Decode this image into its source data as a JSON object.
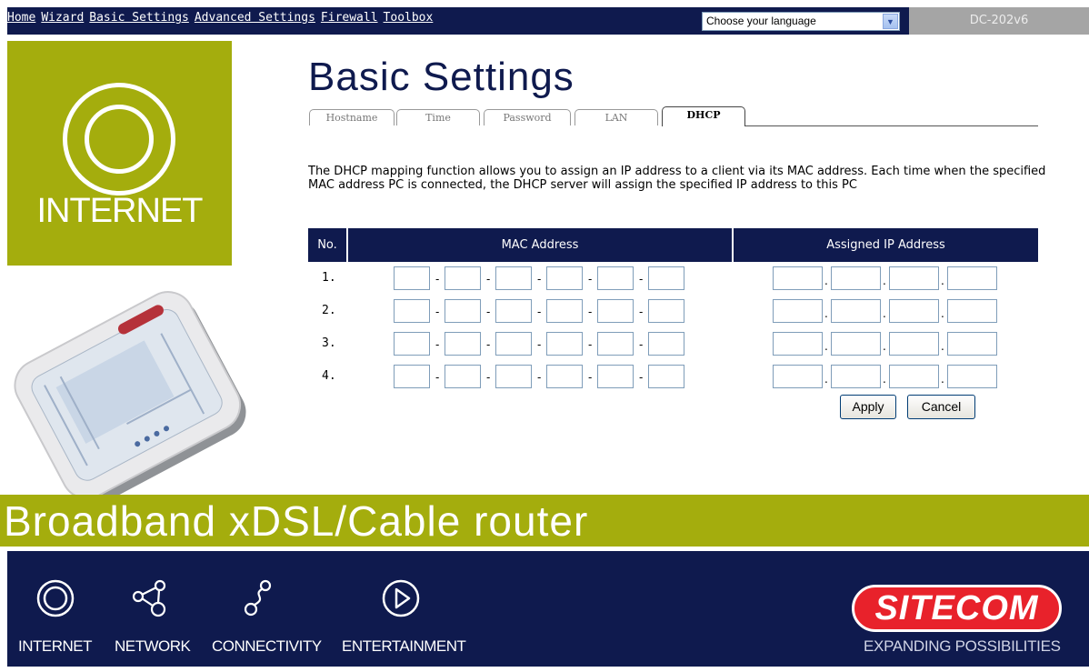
{
  "nav": {
    "items": [
      "Home",
      "Wizard",
      "Basic Settings",
      "Advanced Settings",
      "Firewall",
      "Toolbox"
    ]
  },
  "language": {
    "selected": "Choose your language"
  },
  "model": "DC-202v6",
  "left": {
    "internet_label": "INTERNET"
  },
  "page_title": "Basic Settings",
  "tabs": [
    "Hostname",
    "Time",
    "Password",
    "LAN",
    "DHCP"
  ],
  "active_tab": "DHCP",
  "description": "The DHCP mapping function allows you to assign an IP address to a client via its MAC address. Each time when the specified MAC address PC is connected, the DHCP server will assign the specified IP address to this PC",
  "table": {
    "headers": [
      "No.",
      "MAC Address",
      "Assigned IP Address"
    ],
    "rows": [
      "1.",
      "2.",
      "3.",
      "4."
    ],
    "mac_separator": "-",
    "ip_separator": "."
  },
  "buttons": {
    "apply": "Apply",
    "cancel": "Cancel"
  },
  "banner": "Broadband xDSL/Cable router",
  "footer": {
    "items": [
      "INTERNET",
      "NETWORK",
      "CONNECTIVITY",
      "ENTERTAINMENT"
    ],
    "brand": "SITECOM",
    "tagline": "EXPANDING POSSIBILITIES"
  },
  "colors": {
    "navy": "#0f1a4e",
    "lime": "#a4ad0d",
    "brand_red": "#e8222b"
  }
}
